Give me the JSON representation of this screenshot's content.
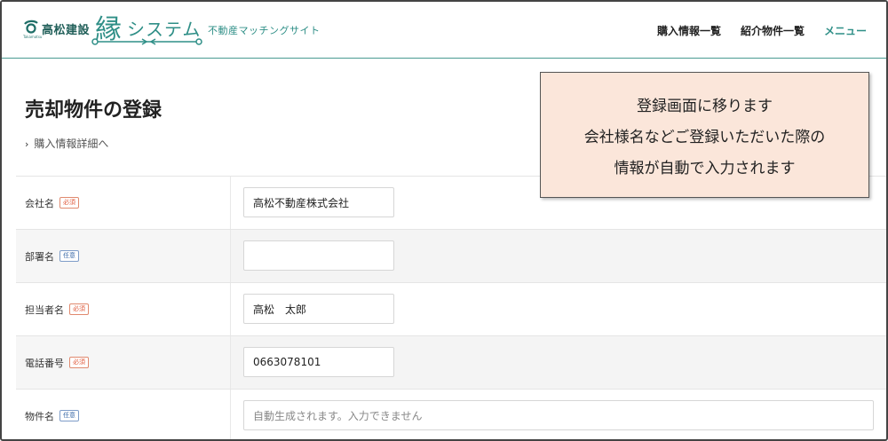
{
  "header": {
    "company_name": "高松建設",
    "logo_sub": "Takamatsu",
    "system_kanji": "縁",
    "system_kana": "システム",
    "tagline": "不動産マッチングサイト",
    "nav": [
      "購入情報一覧",
      "紹介物件一覧",
      "メニュー"
    ]
  },
  "page": {
    "title": "売却物件の登録",
    "back_link": "購入情報詳細へ"
  },
  "callout": {
    "lines": [
      "登録画面に移ります",
      "会社様名などご登録いただいた際の",
      "情報が自動で入力されます"
    ]
  },
  "form": {
    "rows": [
      {
        "label": "会社名",
        "badge": "必須",
        "value": "高松不動産株式会社"
      },
      {
        "label": "部署名",
        "badge": "任意",
        "value": ""
      },
      {
        "label": "担当者名",
        "badge": "必須",
        "value": "高松　太郎"
      },
      {
        "label": "電話番号",
        "badge": "必須",
        "value": "0663078101"
      },
      {
        "label": "物件名",
        "badge": "任意",
        "placeholder": "自動生成されます。入力できません"
      }
    ]
  },
  "colors": {
    "brand": "#2f8f87",
    "required": "#e0593a",
    "optional": "#3b6aa8",
    "callout_bg": "#fbe6da"
  }
}
